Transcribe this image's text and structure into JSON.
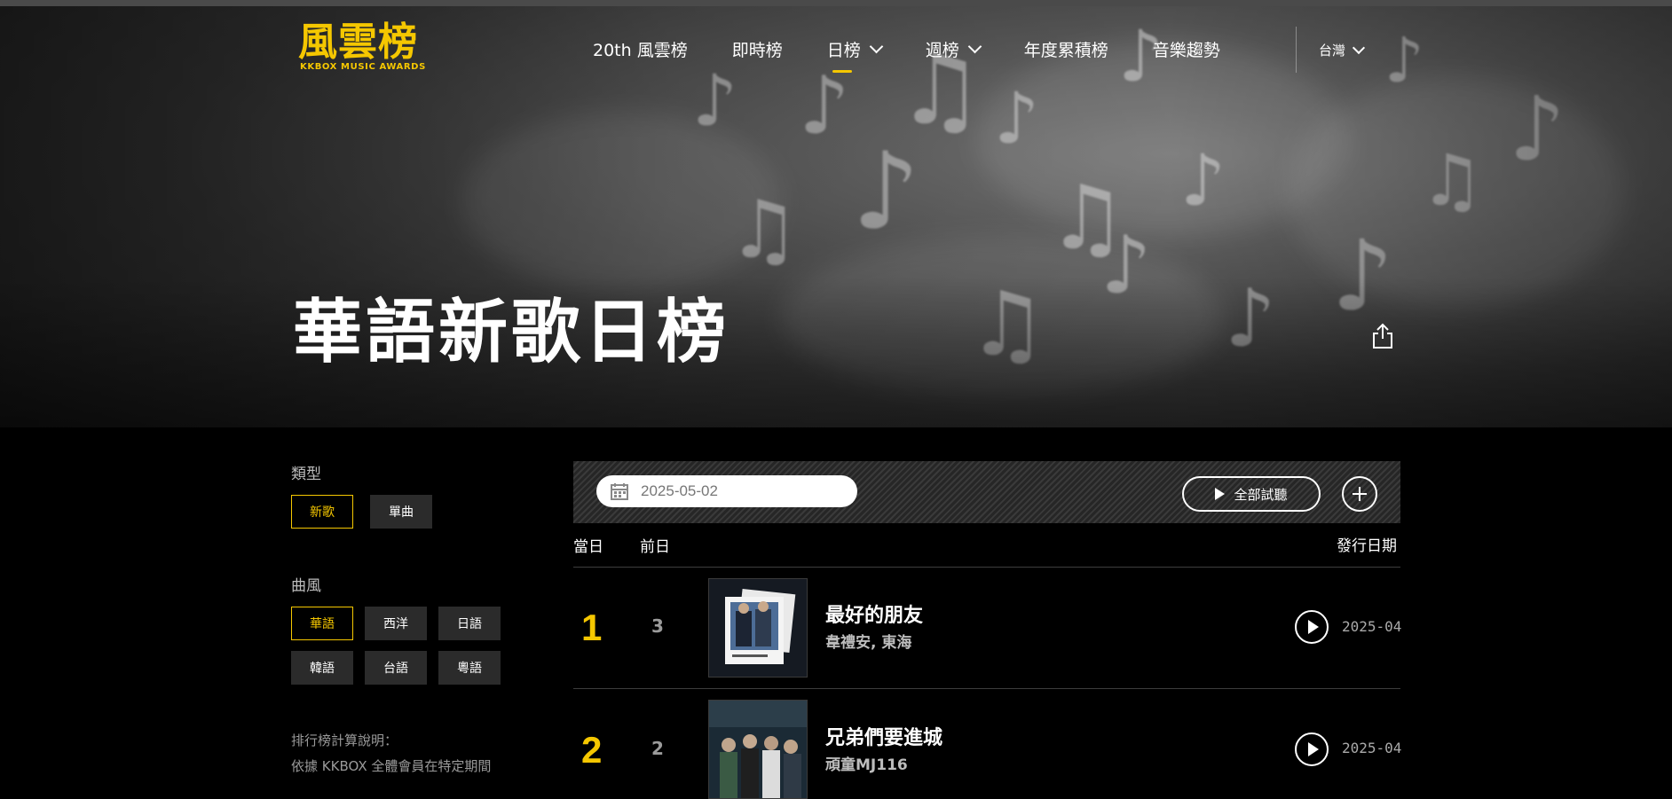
{
  "header": {
    "logo_text": "風雲榜",
    "logo_subtitle": "KKBOX MUSIC AWARDS",
    "nav": [
      {
        "label": "20th 風雲榜"
      },
      {
        "label": "即時榜"
      },
      {
        "label": "日榜"
      },
      {
        "label": "週榜"
      },
      {
        "label": "年度累積榜"
      },
      {
        "label": "音樂趨勢"
      }
    ],
    "region": "台灣"
  },
  "page": {
    "title": "華語新歌日榜"
  },
  "sidebar": {
    "type_label": "類型",
    "type_options": [
      "新歌",
      "單曲"
    ],
    "type_selected": "新歌",
    "genre_label": "曲風",
    "genre_options": [
      "華語",
      "西洋",
      "日語",
      "韓語",
      "台語",
      "粵語"
    ],
    "genre_selected": "華語",
    "note_title": "排行榜計算說明：",
    "note_text": "依據 KKBOX 全體會員在特定期間"
  },
  "toolbar": {
    "date": "2025-05-02",
    "play_all_label": "全部試聽"
  },
  "table": {
    "col_today": "當日",
    "col_prev": "前日",
    "col_release": "發行日期",
    "rows": [
      {
        "rank": "1",
        "prev": "3",
        "title": "最好的朋友",
        "artist": "韋禮安, 東海",
        "release": "2025-04"
      },
      {
        "rank": "2",
        "prev": "2",
        "title": "兄弟們要進城",
        "artist": "頑童MJ116",
        "release": "2025-04"
      }
    ]
  },
  "colors": {
    "accent": "#f5c700",
    "background": "#000000"
  }
}
